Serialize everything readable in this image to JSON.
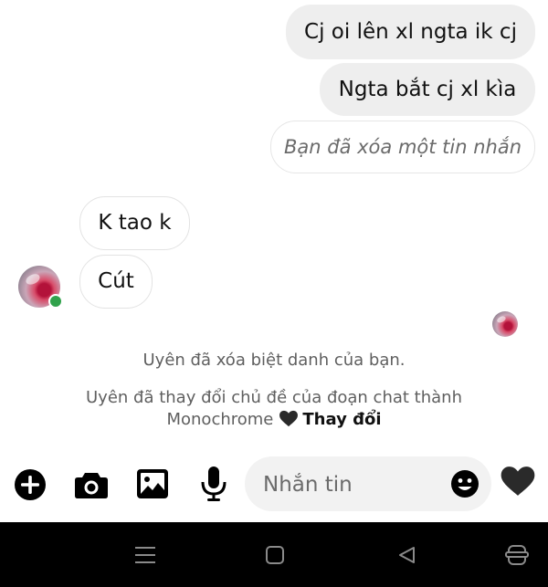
{
  "messages": {
    "sent": [
      "Cj oi lên xl ngta ik cj",
      "Ngta bắt cj xl kìa"
    ],
    "deleted_notice": "Bạn đã xóa một tin nhắn",
    "received": [
      "K tao k",
      "Cút"
    ]
  },
  "system_messages": {
    "nickname_removed": "Uyên đã xóa biệt danh của bạn.",
    "theme_changed_line1": "Uyên đã thay đổi chủ đề của đoạn chat thành",
    "theme_name": "Monochrome",
    "change_link": "Thay đổi"
  },
  "composer": {
    "placeholder": "Nhắn tin",
    "icons": [
      "plus-icon",
      "camera-icon",
      "image-icon",
      "microphone-icon",
      "emoji-icon",
      "heart-icon"
    ]
  },
  "colors": {
    "online": "#31a24c",
    "sent_bubble": "#eeeeee",
    "icon": "#000000"
  }
}
